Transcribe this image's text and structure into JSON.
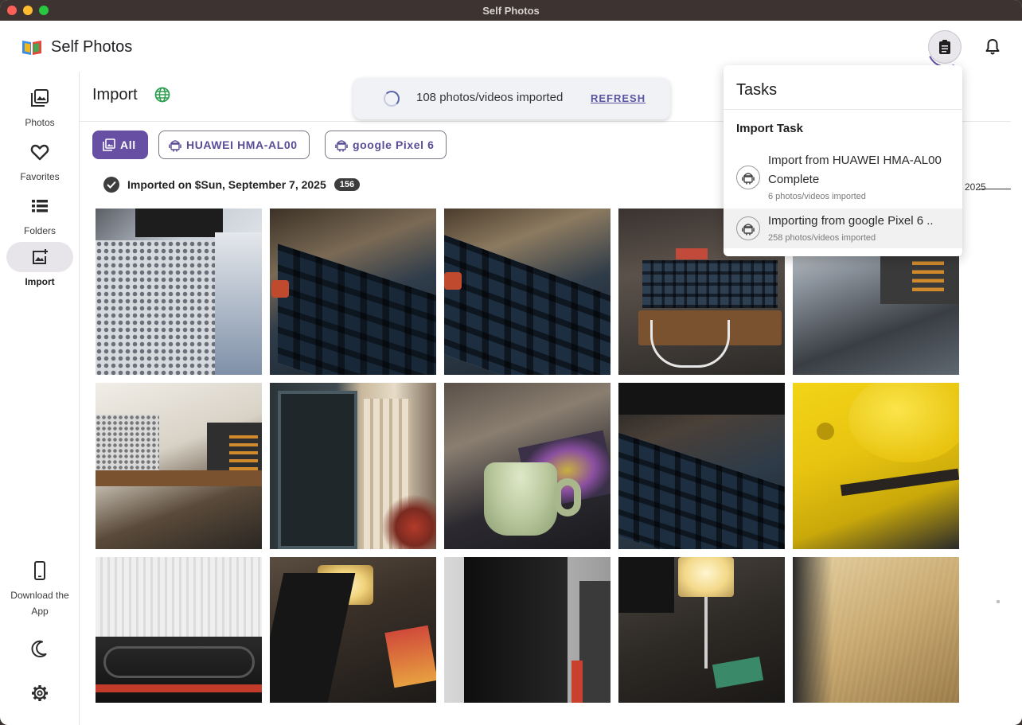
{
  "window": {
    "title": "Self Photos"
  },
  "app": {
    "name": "Self Photos"
  },
  "sidebar": {
    "items": [
      {
        "label": "Photos",
        "icon": "photos-icon"
      },
      {
        "label": "Favorites",
        "icon": "heart-icon"
      },
      {
        "label": "Folders",
        "icon": "folders-icon"
      },
      {
        "label": "Import",
        "icon": "import-icon",
        "active": true
      }
    ],
    "bottom": {
      "download_label": "Download the App",
      "theme_icon": "moon-icon",
      "settings_icon": "gear-icon"
    }
  },
  "page": {
    "title": "Import"
  },
  "toast": {
    "text": "108 photos/videos imported",
    "action": "REFRESH"
  },
  "filters": [
    {
      "label": "All",
      "active": true
    },
    {
      "label": "HUAWEI HMA-AL00",
      "active": false
    },
    {
      "label": "google Pixel 6",
      "active": false
    }
  ],
  "section": {
    "label": "Imported on $Sun, September 7, 2025",
    "count": "156"
  },
  "side_year": "2025",
  "tasks_panel": {
    "title": "Tasks",
    "subtitle": "Import Task",
    "tasks": [
      {
        "title": "Import from HUAWEI HMA-AL00 Complete",
        "detail": "6 photos/videos imported"
      },
      {
        "title": "Importing from google Pixel 6 ..",
        "detail": "258 photos/videos imported"
      }
    ]
  },
  "colors": {
    "accent": "#6750a4",
    "chip_text": "#5a4c96",
    "globe": "#2e9e4f"
  }
}
